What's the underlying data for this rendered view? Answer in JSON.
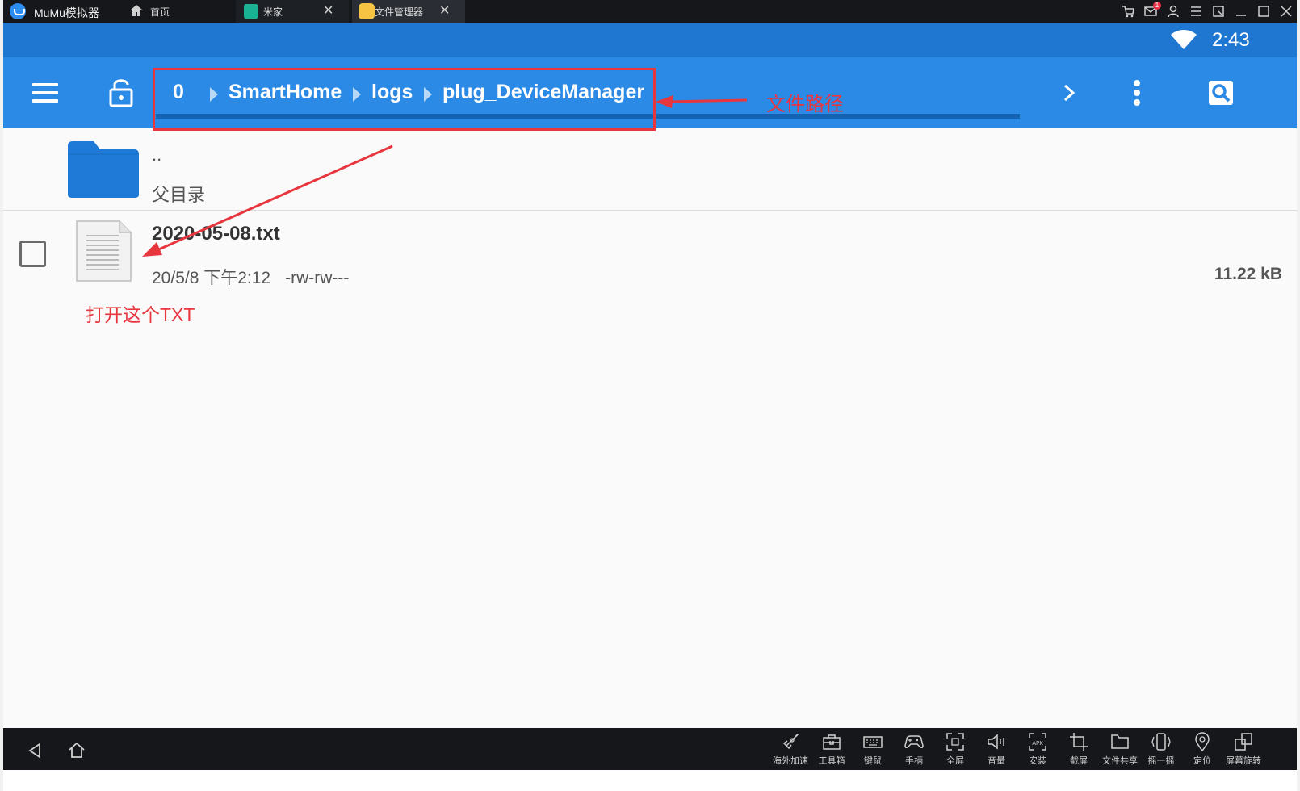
{
  "window": {
    "app_name": "MuMu模拟器",
    "tabs": [
      {
        "label": "首页"
      },
      {
        "label": "米家"
      },
      {
        "label": "文件管理器"
      }
    ],
    "close_glyph": "✕",
    "badge_count": "1"
  },
  "status_bar": {
    "time": "2:43"
  },
  "breadcrumb": {
    "items": [
      "0",
      "SmartHome",
      "logs",
      "plug_DeviceManager"
    ]
  },
  "list": {
    "parent": {
      "name": "..",
      "label": "父目录"
    },
    "files": [
      {
        "name": "2020-05-08.txt",
        "date": "20/5/8 下午2:12",
        "permissions": "-rw-rw---",
        "size": "11.22 kB"
      }
    ]
  },
  "annotations": {
    "path_label": "文件路径",
    "open_label": "打开这个TXT",
    "color": "#e8363f"
  },
  "toolbar": {
    "items": [
      {
        "label": "海外加速",
        "icon": "rocket-icon"
      },
      {
        "label": "工具箱",
        "icon": "toolbox-icon"
      },
      {
        "label": "键鼠",
        "icon": "keyboard-icon"
      },
      {
        "label": "手柄",
        "icon": "gamepad-icon"
      },
      {
        "label": "全屏",
        "icon": "fullscreen-icon"
      },
      {
        "label": "音量",
        "icon": "volume-icon"
      },
      {
        "label": "安装",
        "icon": "apk-icon"
      },
      {
        "label": "截屏",
        "icon": "crop-icon"
      },
      {
        "label": "文件共享",
        "icon": "folder-icon"
      },
      {
        "label": "摇一摇",
        "icon": "shake-icon"
      },
      {
        "label": "定位",
        "icon": "location-icon"
      },
      {
        "label": "屏幕旋转",
        "icon": "rotate-icon"
      }
    ]
  },
  "colors": {
    "status_bar": "#1f77d2",
    "app_bar": "#2b8ae6",
    "title_bar": "#15171b",
    "folder": "#1e7ad6"
  }
}
